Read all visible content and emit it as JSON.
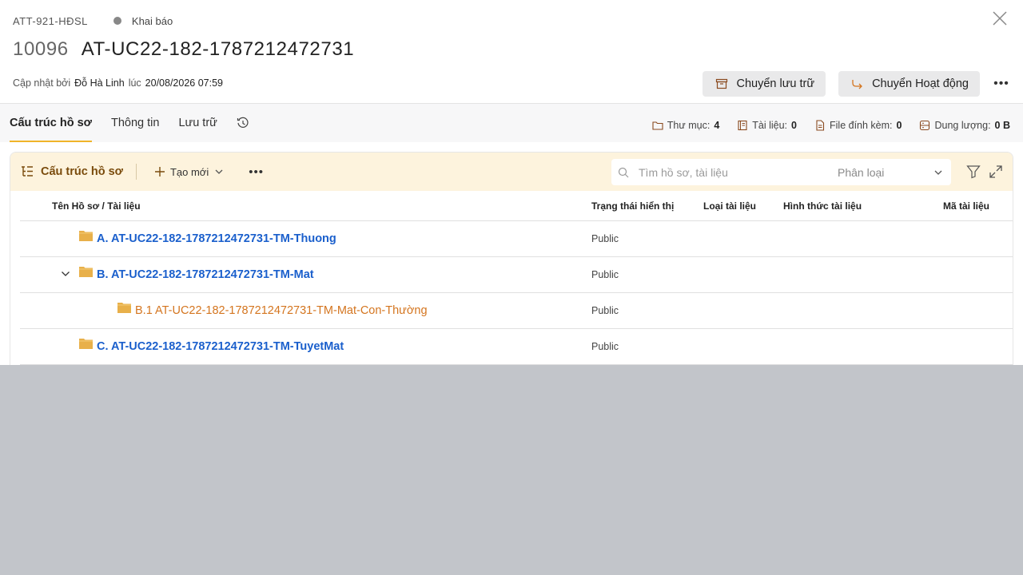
{
  "header": {
    "code": "ATT-921-HĐSL",
    "status": "Khai báo",
    "number": "10096",
    "name": "AT-UC22-182-1787212472731",
    "updated_by_label": "Cập nhật bởi",
    "updated_by": "Đỗ Hà Linh",
    "at_label": "lúc",
    "updated_at": "20/08/2026 07:59",
    "archive_button": "Chuyển lưu trữ",
    "activate_button": "Chuyển Hoạt động"
  },
  "tabs": [
    {
      "label": "Cấu trúc hồ sơ"
    },
    {
      "label": "Thông tin"
    },
    {
      "label": "Lưu trữ"
    }
  ],
  "stats": {
    "folders_label": "Thư mục:",
    "folders": "4",
    "documents_label": "Tài liệu:",
    "documents": "0",
    "attachments_label": "File đính kèm:",
    "attachments": "0",
    "capacity_label": "Dung lượng:",
    "capacity": "0 B"
  },
  "toolbar": {
    "title": "Cấu trúc hồ sơ",
    "create": "Tạo mới",
    "search_placeholder": "Tìm hồ sơ, tài liệu",
    "classify": "Phân loại"
  },
  "table": {
    "columns": [
      "Tên Hồ sơ / Tài liệu",
      "Trạng thái hiển thị",
      "Loại tài liệu",
      "Hình thức tài liệu",
      "Mã tài liệu"
    ],
    "rows": [
      {
        "name": "A. AT-UC22-182-1787212472731-TM-Thuong",
        "status": "Public"
      },
      {
        "name": "B. AT-UC22-182-1787212472731-TM-Mat",
        "status": "Public"
      },
      {
        "name": "B.1 AT-UC22-182-1787212472731-TM-Mat-Con-Thường",
        "status": "Public"
      },
      {
        "name": "C. AT-UC22-182-1787212472731-TM-TuyetMat",
        "status": "Public"
      }
    ]
  },
  "colors": {
    "accent": "#f0b429",
    "toolbar_bg": "#fdf3dd",
    "link_blue": "#1a5fcc",
    "child_orange": "#d4751f",
    "folder": "#e8b04a"
  }
}
